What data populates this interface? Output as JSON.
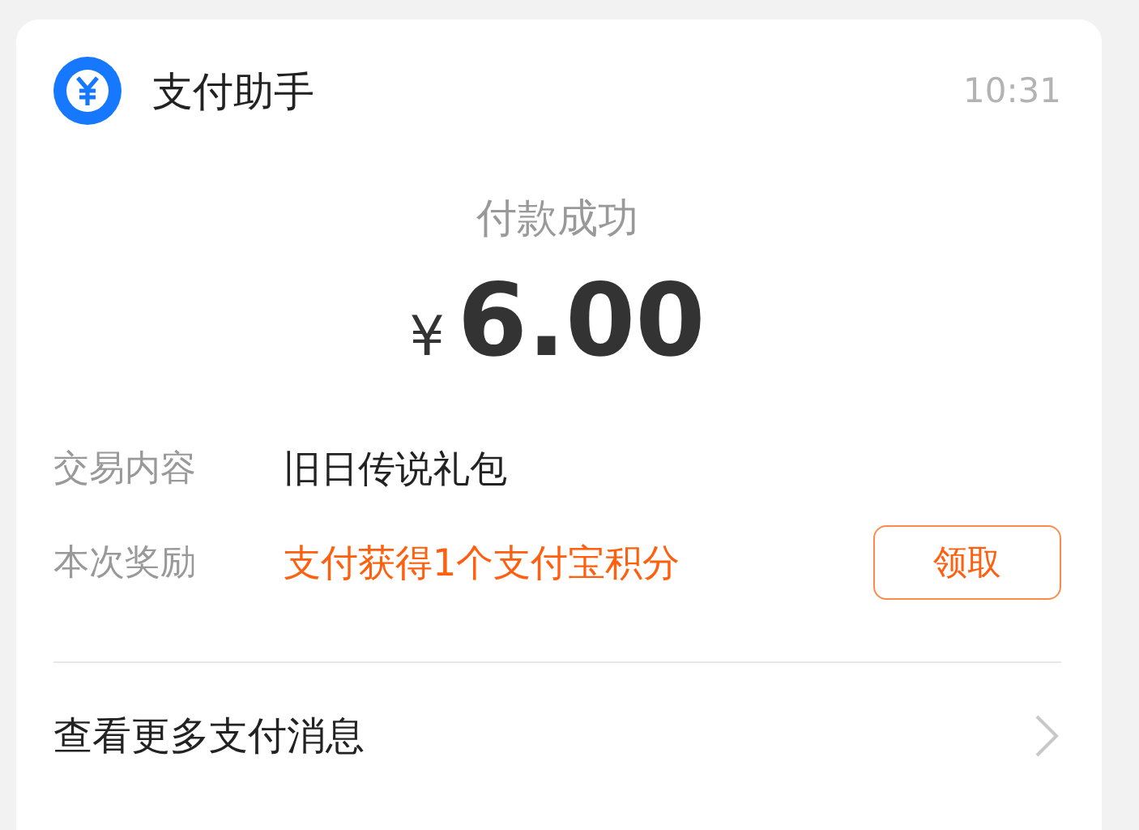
{
  "header": {
    "title": "支付助手",
    "time": "10:31"
  },
  "status": "付款成功",
  "amount": {
    "currency": "¥",
    "value": "6.00"
  },
  "details": [
    {
      "kind": "text",
      "label": "交易内容",
      "value": "旧日传说礼包"
    },
    {
      "kind": "reward",
      "label": "本次奖励",
      "value": "支付获得1个支付宝积分",
      "button": "领取"
    }
  ],
  "footer_link": "查看更多支付消息"
}
